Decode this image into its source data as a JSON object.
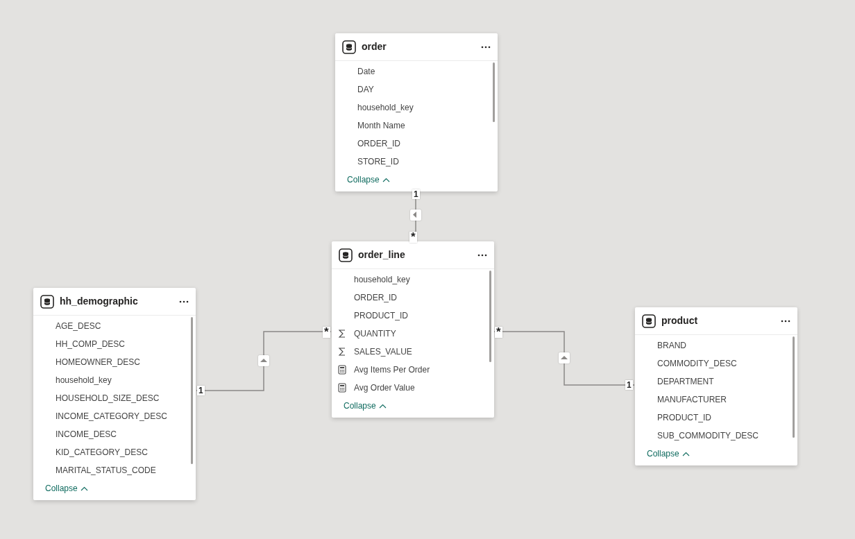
{
  "tables": [
    {
      "name": "order",
      "collapse": "Collapse",
      "fields": [
        {
          "name": "Date",
          "kind": "plain"
        },
        {
          "name": "DAY",
          "kind": "plain"
        },
        {
          "name": "household_key",
          "kind": "plain"
        },
        {
          "name": "Month Name",
          "kind": "plain"
        },
        {
          "name": "ORDER_ID",
          "kind": "plain"
        },
        {
          "name": "STORE_ID",
          "kind": "plain"
        }
      ]
    },
    {
      "name": "order_line",
      "collapse": "Collapse",
      "fields": [
        {
          "name": "household_key",
          "kind": "plain"
        },
        {
          "name": "ORDER_ID",
          "kind": "plain"
        },
        {
          "name": "PRODUCT_ID",
          "kind": "plain"
        },
        {
          "name": "QUANTITY",
          "kind": "sum"
        },
        {
          "name": "SALES_VALUE",
          "kind": "sum"
        },
        {
          "name": "Avg Items Per Order",
          "kind": "measure"
        },
        {
          "name": "Avg Order Value",
          "kind": "measure"
        }
      ]
    },
    {
      "name": "hh_demographic",
      "collapse": "Collapse",
      "fields": [
        {
          "name": "AGE_DESC",
          "kind": "plain"
        },
        {
          "name": "HH_COMP_DESC",
          "kind": "plain"
        },
        {
          "name": "HOMEOWNER_DESC",
          "kind": "plain"
        },
        {
          "name": "household_key",
          "kind": "plain"
        },
        {
          "name": "HOUSEHOLD_SIZE_DESC",
          "kind": "plain"
        },
        {
          "name": "INCOME_CATEGORY_DESC",
          "kind": "plain"
        },
        {
          "name": "INCOME_DESC",
          "kind": "plain"
        },
        {
          "name": "KID_CATEGORY_DESC",
          "kind": "plain"
        },
        {
          "name": "MARITAL_STATUS_CODE",
          "kind": "plain"
        }
      ]
    },
    {
      "name": "product",
      "collapse": "Collapse",
      "fields": [
        {
          "name": "BRAND",
          "kind": "plain"
        },
        {
          "name": "COMMODITY_DESC",
          "kind": "plain"
        },
        {
          "name": "DEPARTMENT",
          "kind": "plain"
        },
        {
          "name": "MANUFACTURER",
          "kind": "plain"
        },
        {
          "name": "PRODUCT_ID",
          "kind": "plain"
        },
        {
          "name": "SUB_COMMODITY_DESC",
          "kind": "plain"
        }
      ]
    }
  ],
  "relationships": [
    {
      "one_label": "1",
      "many_label": "*",
      "kind": "left"
    },
    {
      "one_label": "1",
      "many_label": "*",
      "kind": "up"
    },
    {
      "one_label": "1",
      "many_label": "*",
      "kind": "up"
    }
  ]
}
